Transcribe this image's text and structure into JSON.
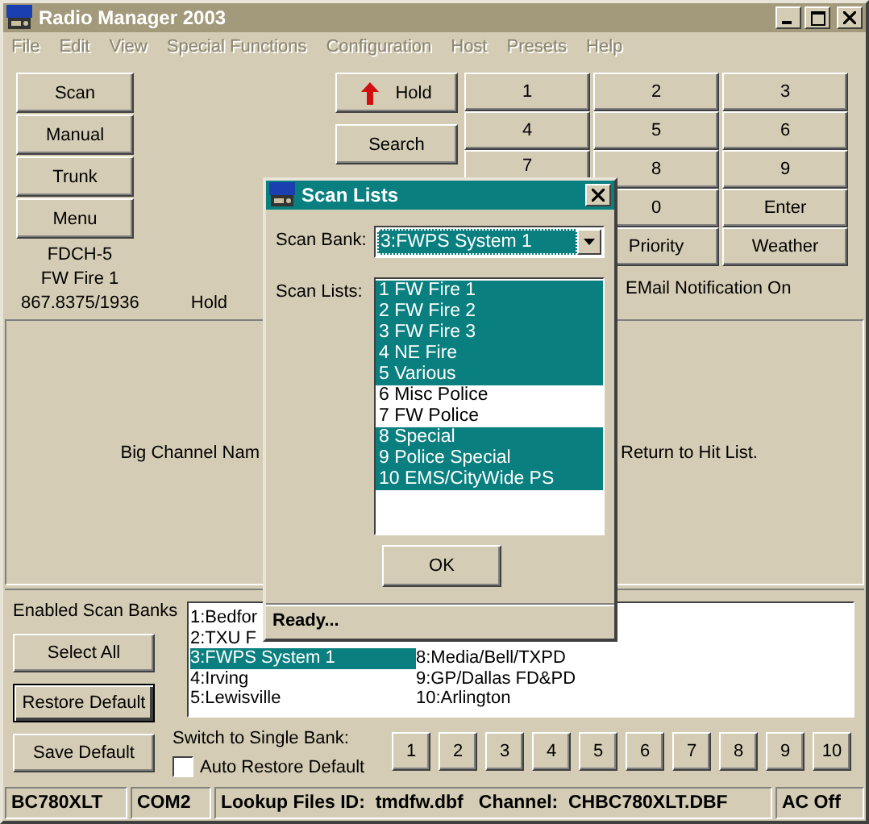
{
  "window": {
    "title": "Radio Manager 2003"
  },
  "menu": [
    {
      "label": "File",
      "disabled": true
    },
    {
      "label": "Edit",
      "disabled": true
    },
    {
      "label": "View",
      "disabled": true
    },
    {
      "label": "Special Functions",
      "disabled": true
    },
    {
      "label": "Configuration",
      "disabled": true
    },
    {
      "label": "Host",
      "disabled": true
    },
    {
      "label": "Presets",
      "disabled": true
    },
    {
      "label": "Help",
      "disabled": true
    }
  ],
  "mode_buttons": [
    "Scan",
    "Manual",
    "Trunk",
    "Menu"
  ],
  "channel_info": {
    "tag": "FDCH-5",
    "name": "FW Fire 1",
    "frequency": "867.8375/1936",
    "mode": "Hold"
  },
  "hold_button": "Hold",
  "search_button": "Search",
  "keypad": [
    [
      "1",
      "4",
      "7"
    ],
    [
      "2",
      "5",
      "8",
      "0",
      "Priority"
    ],
    [
      "3",
      "6",
      "9",
      "Enter",
      "Weather"
    ]
  ],
  "email_notification": "EMail Notification On",
  "display_panel": {
    "channel_name": "Big Channel Nam",
    "hit_list": "Return to Hit List."
  },
  "scan_banks": {
    "label": "Enabled Scan Banks",
    "buttons": [
      {
        "label": "Select All",
        "focused": false
      },
      {
        "label": "Restore Default",
        "focused": true
      },
      {
        "label": "Save Default",
        "focused": false
      }
    ],
    "banks": [
      [
        {
          "label": "1:Bedfor",
          "selected": false
        },
        {
          "label": "2:TXU F",
          "selected": false
        },
        {
          "label": "3:FWPS System 1",
          "selected": true
        },
        {
          "label": "4:Irving",
          "selected": false
        },
        {
          "label": "5:Lewisville",
          "selected": false
        }
      ],
      [
        {
          "label": "8:Media/Bell/TXPD",
          "selected": false
        },
        {
          "label": "9:GP/Dallas FD&PD",
          "selected": false
        },
        {
          "label": "10:Arlington",
          "selected": false
        }
      ]
    ]
  },
  "single_bank": {
    "label": "Switch to Single Bank:",
    "buttons": [
      "1",
      "2",
      "3",
      "4",
      "5",
      "6",
      "7",
      "8",
      "9",
      "10"
    ]
  },
  "auto_restore": {
    "label": "Auto Restore Default",
    "checked": false
  },
  "status_bar": [
    "BC780XLT",
    "COM2",
    "Lookup Files ID:  tmdfw.dbf   Channel:  CHBC780XLT.DBF",
    "AC Off"
  ],
  "dialog": {
    "title": "Scan Lists",
    "bank_label": "Scan Bank:",
    "bank_value": "3:FWPS System 1",
    "lists_label": "Scan Lists:",
    "lists": [
      {
        "label": "1 FW Fire 1",
        "selected": true
      },
      {
        "label": "2 FW Fire 2",
        "selected": true
      },
      {
        "label": "3 FW Fire 3",
        "selected": true
      },
      {
        "label": "4 NE Fire",
        "selected": true
      },
      {
        "label": "5 Various",
        "selected": true
      },
      {
        "label": "6 Misc Police",
        "selected": false
      },
      {
        "label": "7 FW Police",
        "selected": false
      },
      {
        "label": "8 Special",
        "selected": true
      },
      {
        "label": "9 Police Special",
        "selected": true
      },
      {
        "label": "10 EMS/CityWide PS",
        "selected": true
      }
    ],
    "ok_button": "OK",
    "status": "Ready..."
  }
}
